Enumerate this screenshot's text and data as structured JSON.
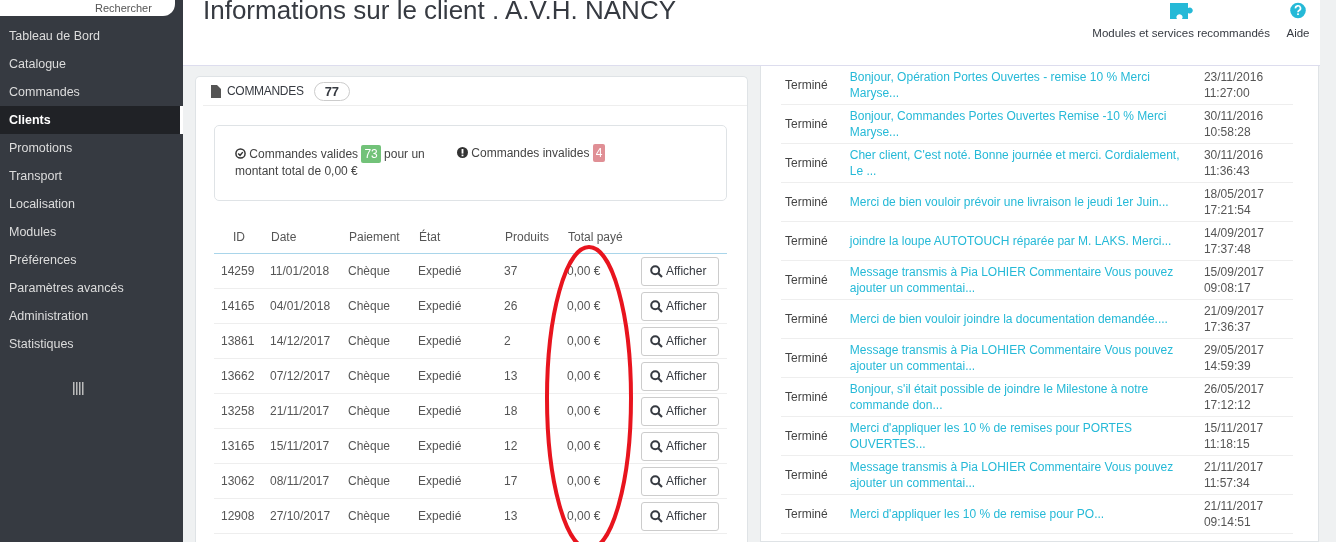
{
  "sidebar": {
    "search": {
      "placeholder": "Rechercher"
    },
    "items": [
      {
        "label": "Tableau de Bord",
        "selected": false
      },
      {
        "label": "Catalogue",
        "selected": false
      },
      {
        "label": "Commandes",
        "selected": false
      },
      {
        "label": "Clients",
        "selected": true
      },
      {
        "label": "Promotions",
        "selected": false
      },
      {
        "label": "Transport",
        "selected": false
      },
      {
        "label": "Localisation",
        "selected": false
      },
      {
        "label": "Modules",
        "selected": false
      },
      {
        "label": "Préférences",
        "selected": false
      },
      {
        "label": "Paramètres avancés",
        "selected": false
      },
      {
        "label": "Administration",
        "selected": false
      },
      {
        "label": "Statistiques",
        "selected": false
      }
    ]
  },
  "header": {
    "title": "Informations sur le client . A.V.H. NANCY",
    "actions": [
      {
        "label": "Modules et services recommandés",
        "kind": "puzzle"
      },
      {
        "label": "Aide",
        "kind": "help"
      }
    ]
  },
  "orders": {
    "title": "COMMANDES",
    "count": "77",
    "valid": {
      "label": "Commandes valides",
      "count": "73",
      "text": "pour un montant total de 0,00 €"
    },
    "invalid": {
      "label": "Commandes invalides",
      "count": "4"
    },
    "columns": [
      "ID",
      "Date",
      "Paiement",
      "État",
      "Produits",
      "Total payé"
    ],
    "rows": [
      {
        "cells": [
          "14259",
          "11/01/2018",
          "Chèque",
          "Expedié",
          "37",
          "0,00 €"
        ],
        "action": "Afficher"
      },
      {
        "cells": [
          "14165",
          "04/01/2018",
          "Chèque",
          "Expedié",
          "26",
          "0,00 €"
        ],
        "action": "Afficher"
      },
      {
        "cells": [
          "13861",
          "14/12/2017",
          "Chèque",
          "Expedié",
          "2",
          "0,00 €"
        ],
        "action": "Afficher"
      },
      {
        "cells": [
          "13662",
          "07/12/2017",
          "Chèque",
          "Expedié",
          "13",
          "0,00 €"
        ],
        "action": "Afficher"
      },
      {
        "cells": [
          "13258",
          "21/11/2017",
          "Chèque",
          "Expedié",
          "18",
          "0,00 €"
        ],
        "action": "Afficher"
      },
      {
        "cells": [
          "13165",
          "15/11/2017",
          "Chèque",
          "Expedié",
          "12",
          "0,00 €"
        ],
        "action": "Afficher"
      },
      {
        "cells": [
          "13062",
          "08/11/2017",
          "Chèque",
          "Expedié",
          "17",
          "0,00 €"
        ],
        "action": "Afficher"
      },
      {
        "cells": [
          "12908",
          "27/10/2017",
          "Chèque",
          "Expedié",
          "13",
          "0,00 €"
        ],
        "action": "Afficher"
      }
    ]
  },
  "messages": {
    "rows": [
      {
        "status": "Terminé",
        "message": "Bonjour, Opération Portes Ouvertes - remise 10 % Merci Maryse...",
        "date": "23/11/2016 11:27:00"
      },
      {
        "status": "Terminé",
        "message": "Bonjour, Commandes Portes Ouvertes Remise -10 % Merci Maryse...",
        "date": "30/11/2016 10:58:28"
      },
      {
        "status": "Terminé",
        "message": "Cher client, C'est noté. Bonne journée et merci. Cordialement, Le ...",
        "date": "30/11/2016 11:36:43"
      },
      {
        "status": "Terminé",
        "message": "Merci de bien vouloir prévoir une livraison le jeudi 1er Juin...",
        "date": "18/05/2017 17:21:54"
      },
      {
        "status": "Terminé",
        "message": "joindre la loupe AUTOTOUCH réparée par M. LAKS. Merci...",
        "date": "14/09/2017 17:37:48"
      },
      {
        "status": "Terminé",
        "message": "Message transmis à Pia LOHIER Commentaire Vous pouvez ajouter un commentai...",
        "date": "15/09/2017 09:08:17"
      },
      {
        "status": "Terminé",
        "message": "Merci de bien vouloir joindre la documentation demandée....",
        "date": "21/09/2017 17:36:37"
      },
      {
        "status": "Terminé",
        "message": "Message transmis à Pia LOHIER Commentaire Vous pouvez ajouter un commentai...",
        "date": "29/05/2017 14:59:39"
      },
      {
        "status": "Terminé",
        "message": "Bonjour, s'il était possible de joindre le Milestone à notre commande don...",
        "date": "26/05/2017 17:12:12"
      },
      {
        "status": "Terminé",
        "message": "Merci d'appliquer les 10 % de remises pour PORTES OUVERTES...",
        "date": "15/11/2017 11:18:15"
      },
      {
        "status": "Terminé",
        "message": "Message transmis à Pia LOHIER Commentaire Vous pouvez ajouter un commentai...",
        "date": "21/11/2017 11:57:34"
      },
      {
        "status": "Terminé",
        "message": "Merci d'appliquer les 10 % de remise pour PO...",
        "date": "21/11/2017 09:14:51"
      }
    ]
  }
}
